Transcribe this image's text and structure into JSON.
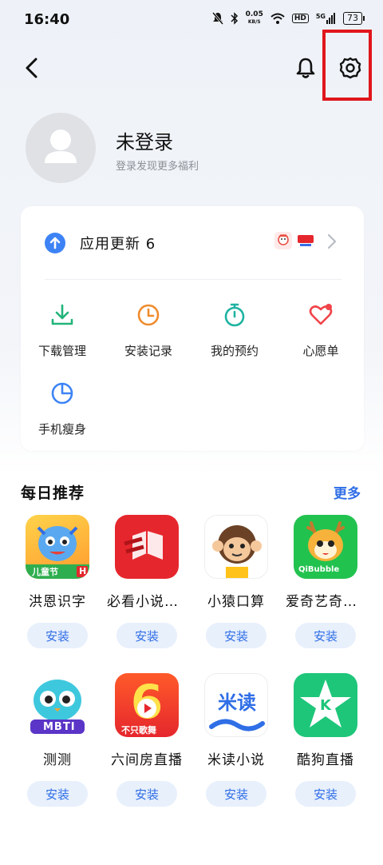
{
  "status_bar": {
    "time": "16:40",
    "net_speed_value": "0.05",
    "net_speed_unit": "KB/S",
    "hd": "HD",
    "signal": "5G",
    "battery": "73"
  },
  "header": {
    "back_icon": "chevron-left-icon",
    "bell_icon": "bell-icon",
    "settings_icon": "gear-icon",
    "highlight_color": "#e0161c"
  },
  "profile": {
    "name": "未登录",
    "hint": "登录发现更多福利"
  },
  "updates": {
    "label": "应用更新 6"
  },
  "tools": [
    {
      "label": "下载管理",
      "icon": "download-icon",
      "color": "#22b47a"
    },
    {
      "label": "安装记录",
      "icon": "clock-icon",
      "color": "#f08b2c"
    },
    {
      "label": "我的预约",
      "icon": "timer-icon",
      "color": "#1fb3a2"
    },
    {
      "label": "心愿单",
      "icon": "heart-icon",
      "color": "#f0444a"
    },
    {
      "label": "手机瘦身",
      "icon": "pie-chart-icon",
      "color": "#3d83f5"
    }
  ],
  "recommend": {
    "title": "每日推荐",
    "more": "更多",
    "install_label": "安装",
    "apps": [
      {
        "name": "洪恩识字",
        "badge": "儿童节",
        "badge2": "H"
      },
      {
        "name": "必看小说阅读器"
      },
      {
        "name": "小猿口算"
      },
      {
        "name": "爱奇艺奇巴布",
        "badge": "QiBubble"
      },
      {
        "name": "测测",
        "badge": "MBTI"
      },
      {
        "name": "六间房直播",
        "badge": "不只歌舞",
        "numeral": "6"
      },
      {
        "name": "米读小说",
        "badge": "米读"
      },
      {
        "name": "酷狗直播",
        "badge": "K"
      }
    ]
  },
  "colors": {
    "accent": "#2f6ee6",
    "install_bg": "#e8f0fc"
  }
}
